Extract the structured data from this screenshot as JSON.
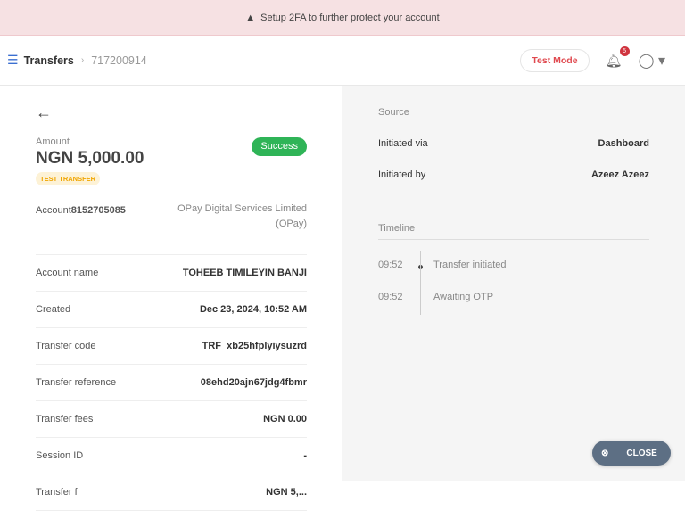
{
  "banner": {
    "text": "Setup 2FA to further protect your account"
  },
  "header": {
    "section": "Transfers",
    "id": "717200914",
    "test_mode": "Test Mode",
    "notifications": "5"
  },
  "transfer": {
    "amount_label": "Amount",
    "amount": "NGN 5,000.00",
    "tag": "TEST TRANSFER",
    "status": "Success",
    "rows": [
      {
        "k": "Account",
        "k2": "8152705085",
        "v": "OPay Digital Services Limited (OPay)"
      },
      {
        "k": "Account name",
        "v": "TOHEEB TIMILEYIN BANJI"
      },
      {
        "k": "Created",
        "v": "Dec 23, 2024, 10:52 AM"
      },
      {
        "k": "Transfer code",
        "v": "TRF_xb25hfplyiysuzrd"
      },
      {
        "k": "Transfer reference",
        "v": "08ehd20ajn67jdg4fbmr"
      },
      {
        "k": "Transfer fees",
        "v": "NGN 0.00"
      },
      {
        "k": "Session ID",
        "v": "-"
      },
      {
        "k": "Transfer f",
        "v": "NGN 5,..."
      }
    ]
  },
  "source": {
    "title": "Source",
    "initiated_via_label": "Initiated via",
    "initiated_via": "Dashboard",
    "initiated_by_label": "Initiated by",
    "initiated_by": "Azeez Azeez"
  },
  "timeline": {
    "title": "Timeline",
    "items": [
      {
        "time": "09:52",
        "event": "Transfer initiated"
      },
      {
        "time": "09:52",
        "event": "Awaiting OTP"
      }
    ]
  },
  "close_label": "CLOSE"
}
